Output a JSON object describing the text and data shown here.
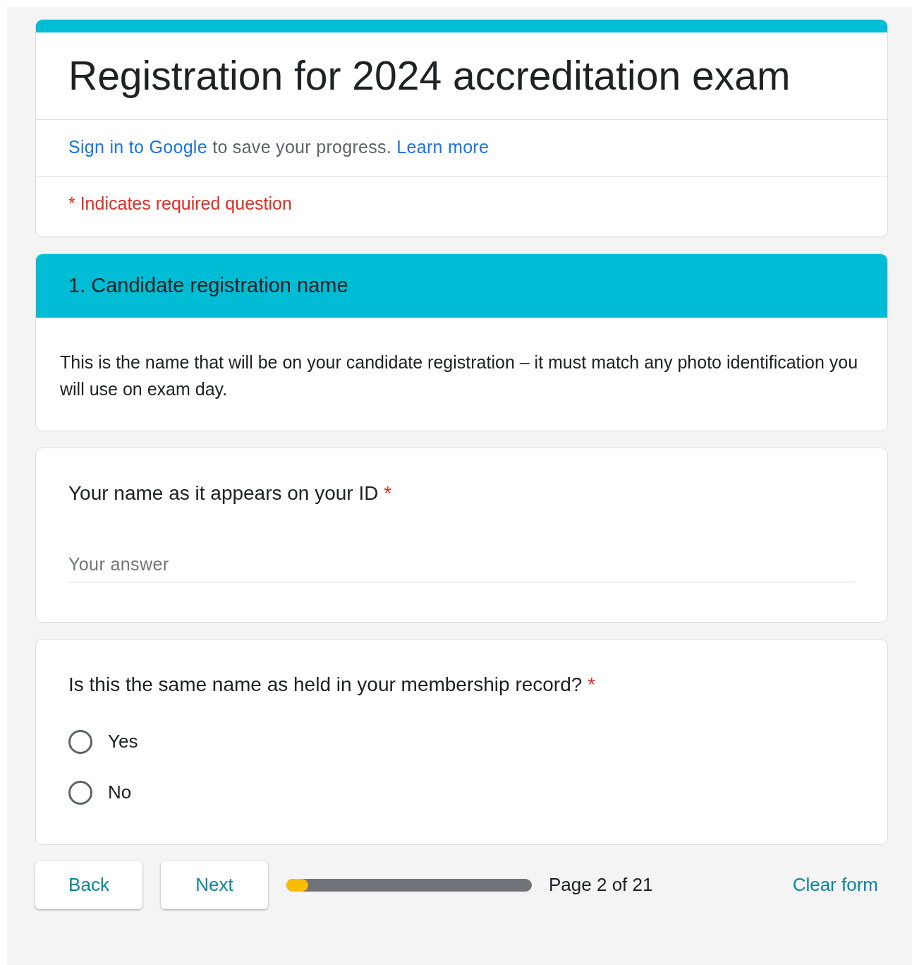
{
  "form": {
    "title": "Registration for 2024 accreditation exam",
    "sign_in": {
      "link": "Sign in to Google",
      "text": "to save your progress.",
      "learn_more": "Learn more"
    },
    "required_note": "* Indicates required question"
  },
  "section": {
    "title": "1. Candidate registration name",
    "description": "This is the name that will be on your candidate registration – it must match any photo identification you will use on exam day."
  },
  "questions": [
    {
      "kind": "text",
      "label": "Your name as it appears on your ID",
      "required_mark": "*",
      "placeholder": "Your answer"
    },
    {
      "kind": "radio",
      "label": "Is this the same name as held in your membership record?",
      "required_mark": "*",
      "options": [
        {
          "label": "Yes",
          "selected": false
        },
        {
          "label": "No",
          "selected": false
        }
      ]
    }
  ],
  "footer": {
    "buttons": [
      "Back",
      "Next"
    ],
    "progress": {
      "level": 0.09
    },
    "page_label": "Page 2 of 21",
    "clear": "Clear form"
  }
}
